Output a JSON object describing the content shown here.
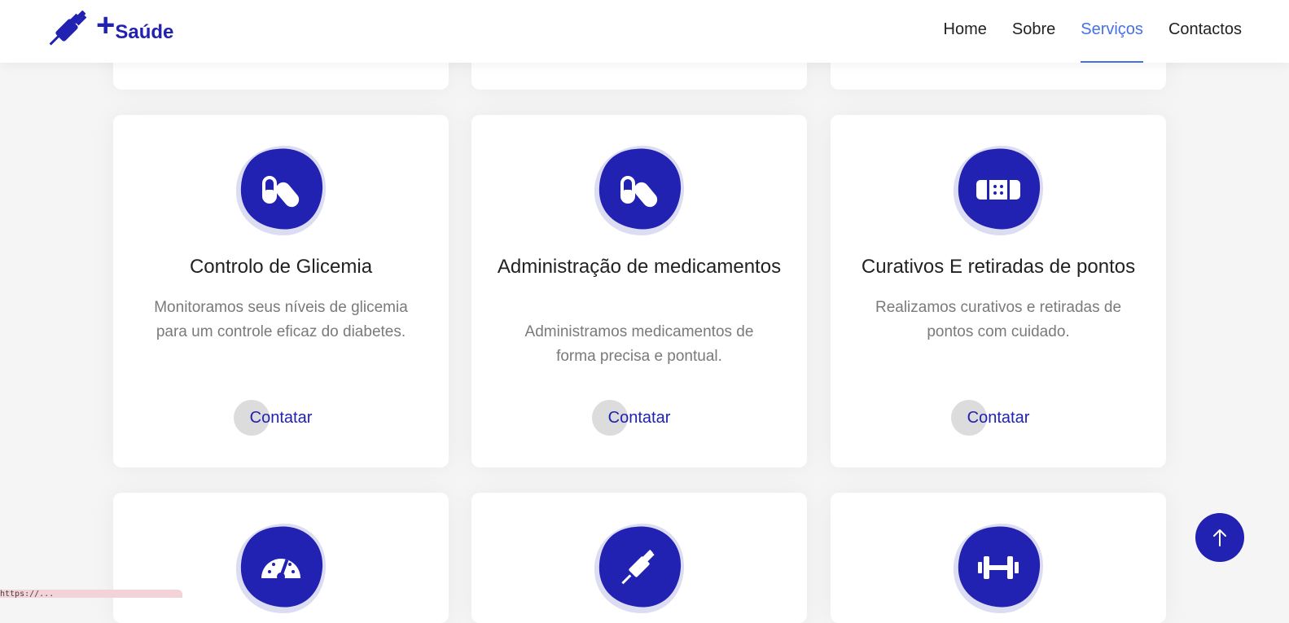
{
  "header": {
    "brand_plus": "+",
    "brand_name": "Saúde",
    "nav": [
      {
        "label": "Home",
        "active": false
      },
      {
        "label": "Sobre",
        "active": false
      },
      {
        "label": "Serviços",
        "active": true
      },
      {
        "label": "Contactos",
        "active": false
      }
    ]
  },
  "colors": {
    "primary": "#2121b2",
    "nav_active": "#4670e6",
    "blob_back": "#dcdcf2"
  },
  "services": [
    {
      "title": "Controlo de Glicemia",
      "description": "Monitoramos seus níveis de glicemia para um controle eficaz do diabetes.",
      "button": "Contatar",
      "icon": "pills-icon"
    },
    {
      "title": "Administração de medicamentos",
      "description": "Administramos medicamentos de forma precisa e pontual.",
      "button": "Contatar",
      "icon": "pills-icon"
    },
    {
      "title": "Curativos E retiradas de pontos",
      "description": "Realizamos curativos e retiradas de pontos com cuidado.",
      "button": "Contatar",
      "icon": "bandage-icon"
    }
  ],
  "next_row_icons": [
    "gauge-icon",
    "syringe-icon",
    "dumbbell-icon"
  ],
  "status_bar": {
    "url": "https://..."
  }
}
